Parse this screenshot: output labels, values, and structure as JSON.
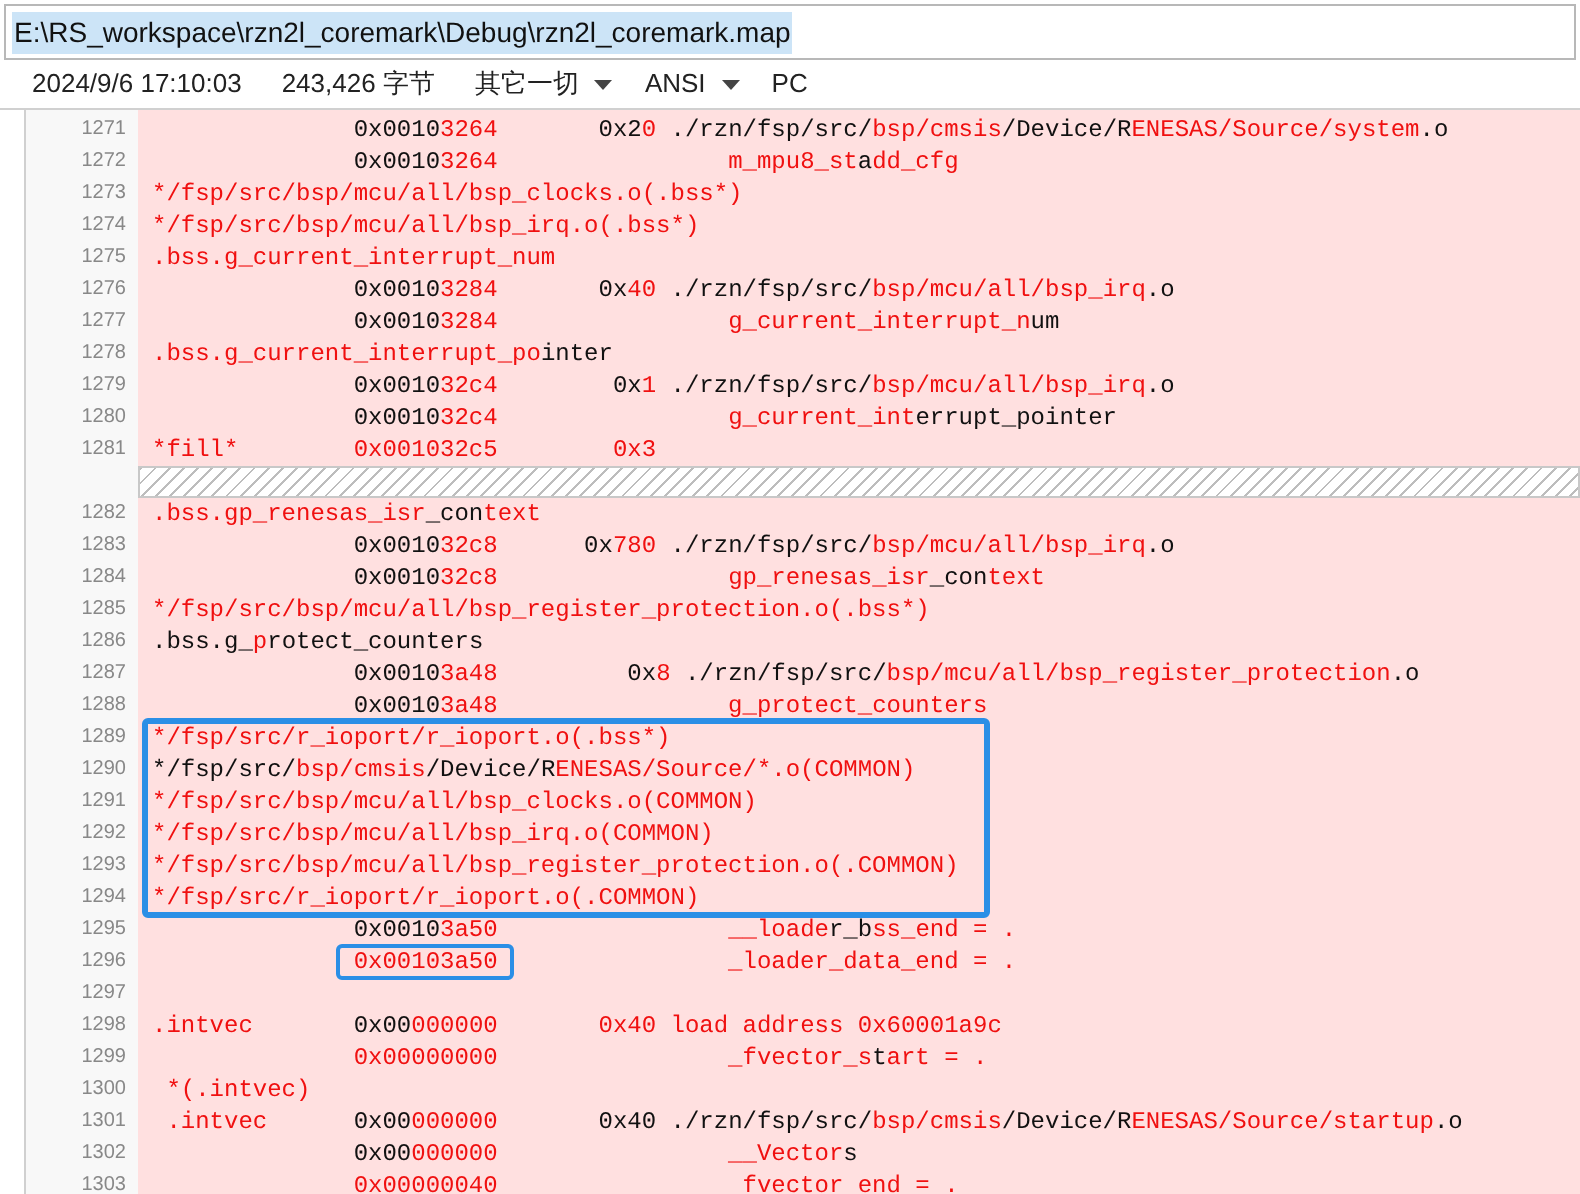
{
  "path_field": {
    "value": "E:\\RS_workspace\\rzn2l_coremark\\Debug\\rzn2l_coremark.map"
  },
  "status_bar": [
    {
      "kind": "text",
      "text": "2024/9/6 17:10:03"
    },
    {
      "kind": "text",
      "text": "243,426 字节"
    },
    {
      "kind": "dropdown",
      "text": "其它一切"
    },
    {
      "kind": "dropdown",
      "text": "ANSI"
    },
    {
      "kind": "text",
      "text": "PC"
    }
  ],
  "lines": [
    {
      "kind": "line",
      "num": "1271",
      "segments": [
        {
          "text": "              0x0010",
          "changed": false
        },
        {
          "text": "3264",
          "changed": true
        },
        {
          "text": "       0x2",
          "changed": false
        },
        {
          "text": "0",
          "changed": true
        },
        {
          "text": " ./rzn/fsp/src/",
          "changed": false
        },
        {
          "text": "bsp/cmsis",
          "changed": true
        },
        {
          "text": "/Device/R",
          "changed": false
        },
        {
          "text": "ENESAS/Source/system",
          "changed": true
        },
        {
          "text": ".o",
          "changed": false
        }
      ]
    },
    {
      "kind": "line",
      "num": "1272",
      "segments": [
        {
          "text": "              0x0010",
          "changed": false
        },
        {
          "text": "3264",
          "changed": true
        },
        {
          "text": "                m_mpu8_st",
          "changed": true
        },
        {
          "text": "a",
          "changed": false
        },
        {
          "text": "dd_cfg",
          "changed": true
        }
      ]
    },
    {
      "kind": "line",
      "num": "1273",
      "segments": [
        {
          "text": "*/fsp/src/bsp/mcu/all/bsp_clocks.o(.bss*)",
          "changed": true
        }
      ]
    },
    {
      "kind": "line",
      "num": "1274",
      "segments": [
        {
          "text": "*/fsp/src/bsp/mcu/all/bsp_irq.o(.bss*)",
          "changed": true
        }
      ]
    },
    {
      "kind": "line",
      "num": "1275",
      "segments": [
        {
          "text": ".bss.g_current_interrupt_num",
          "changed": true
        }
      ]
    },
    {
      "kind": "line",
      "num": "1276",
      "segments": [
        {
          "text": "              0x0010",
          "changed": false
        },
        {
          "text": "3284",
          "changed": true
        },
        {
          "text": "       0x",
          "changed": false
        },
        {
          "text": "40",
          "changed": true
        },
        {
          "text": " ./rzn/fsp/src/",
          "changed": false
        },
        {
          "text": "bsp/mcu/all/bsp_irq",
          "changed": true
        },
        {
          "text": ".o",
          "changed": false
        }
      ]
    },
    {
      "kind": "line",
      "num": "1277",
      "segments": [
        {
          "text": "              0x0010",
          "changed": false
        },
        {
          "text": "3284",
          "changed": true
        },
        {
          "text": "                g_current_interrupt_n",
          "changed": true
        },
        {
          "text": "um",
          "changed": false
        }
      ]
    },
    {
      "kind": "line",
      "num": "1278",
      "segments": [
        {
          "text": ".bss.g_current_interrupt_po",
          "changed": true
        },
        {
          "text": "inter",
          "changed": false
        }
      ]
    },
    {
      "kind": "line",
      "num": "1279",
      "segments": [
        {
          "text": "              0x0010",
          "changed": false
        },
        {
          "text": "32c4",
          "changed": true
        },
        {
          "text": "        0x",
          "changed": false
        },
        {
          "text": "1",
          "changed": true
        },
        {
          "text": " ./rzn/fsp/src/",
          "changed": false
        },
        {
          "text": "bsp/mcu/all/bsp_irq",
          "changed": true
        },
        {
          "text": ".o",
          "changed": false
        }
      ]
    },
    {
      "kind": "line",
      "num": "1280",
      "segments": [
        {
          "text": "              0x0010",
          "changed": false
        },
        {
          "text": "32c4",
          "changed": true
        },
        {
          "text": "                g_current_int",
          "changed": true
        },
        {
          "text": "errupt_pointer",
          "changed": false
        }
      ]
    },
    {
      "kind": "line",
      "num": "1281",
      "segments": [
        {
          "text": "*fill*        0x001032c5        0x3",
          "changed": true
        }
      ]
    },
    {
      "kind": "separator"
    },
    {
      "kind": "line",
      "num": "1282",
      "segments": [
        {
          "text": ".bss.gp_renesas_isr",
          "changed": true
        },
        {
          "text": "_con",
          "changed": false
        },
        {
          "text": "text",
          "changed": true
        }
      ]
    },
    {
      "kind": "line",
      "num": "1283",
      "segments": [
        {
          "text": "              0x0010",
          "changed": false
        },
        {
          "text": "32c8",
          "changed": true
        },
        {
          "text": "      0x",
          "changed": false
        },
        {
          "text": "780",
          "changed": true
        },
        {
          "text": " ./rzn/fsp/src/",
          "changed": false
        },
        {
          "text": "bsp/mcu/all/bsp_irq",
          "changed": true
        },
        {
          "text": ".o",
          "changed": false
        }
      ]
    },
    {
      "kind": "line",
      "num": "1284",
      "segments": [
        {
          "text": "              0x0010",
          "changed": false
        },
        {
          "text": "32c8",
          "changed": true
        },
        {
          "text": "                gp_renesas_isr",
          "changed": true
        },
        {
          "text": "_con",
          "changed": false
        },
        {
          "text": "text",
          "changed": true
        }
      ]
    },
    {
      "kind": "line",
      "num": "1285",
      "segments": [
        {
          "text": "*/fsp/src/bsp/mcu/all/bsp_register_protection.o(.bss*)",
          "changed": true
        }
      ]
    },
    {
      "kind": "line",
      "num": "1286",
      "segments": [
        {
          "text": ".bss.g_",
          "changed": false
        },
        {
          "text": "p",
          "changed": true
        },
        {
          "text": "rotect_counters",
          "changed": false
        }
      ]
    },
    {
      "kind": "line",
      "num": "1287",
      "segments": [
        {
          "text": "              0x0010",
          "changed": false
        },
        {
          "text": "3a48",
          "changed": true
        },
        {
          "text": "         0x",
          "changed": false
        },
        {
          "text": "8",
          "changed": true
        },
        {
          "text": " ./rzn/fsp/src/",
          "changed": false
        },
        {
          "text": "bsp/mcu/all/bsp_register_protection",
          "changed": true
        },
        {
          "text": ".o",
          "changed": false
        }
      ]
    },
    {
      "kind": "line",
      "num": "1288",
      "segments": [
        {
          "text": "              0x0010",
          "changed": false
        },
        {
          "text": "3a48                g_protect_counters",
          "changed": true
        }
      ]
    },
    {
      "kind": "boxed_group",
      "lines": [
        {
          "kind": "line",
          "num": "1289",
          "segments": [
            {
              "text": "*/fsp/src/r_ioport/r_ioport.o(.bss*)",
              "changed": true
            }
          ]
        },
        {
          "kind": "line",
          "num": "1290",
          "segments": [
            {
              "text": "*/fsp/src/",
              "changed": false
            },
            {
              "text": "bsp/cmsis",
              "changed": true
            },
            {
              "text": "/Device/R",
              "changed": false
            },
            {
              "text": "ENESAS/Source/*.o(COMMON)",
              "changed": true
            }
          ]
        },
        {
          "kind": "line",
          "num": "1291",
          "segments": [
            {
              "text": "*/fsp/src/bsp/mcu/all/bsp_clocks.o(COMMON)",
              "changed": true
            }
          ]
        },
        {
          "kind": "line",
          "num": "1292",
          "segments": [
            {
              "text": "*/fsp/src/bsp/mcu/all/bsp_irq.o(COMMON)",
              "changed": true
            }
          ]
        },
        {
          "kind": "line",
          "num": "1293",
          "segments": [
            {
              "text": "*/fsp/src/bsp/mcu/all/bsp_register_protection.o(.COMMON)",
              "changed": true
            }
          ]
        },
        {
          "kind": "line",
          "num": "1294",
          "segments": [
            {
              "text": "*/fsp/src/r_ioport/r_ioport.o(.COMMON)",
              "changed": true
            }
          ]
        }
      ]
    },
    {
      "kind": "line",
      "num": "1295",
      "segments": [
        {
          "text": "              0x0010",
          "changed": false
        },
        {
          "text": "3a50",
          "changed": true
        },
        {
          "text": "                __loade",
          "changed": true
        },
        {
          "text": "r_b",
          "changed": false
        },
        {
          "text": "ss_end = .",
          "changed": true
        }
      ]
    },
    {
      "kind": "line",
      "num": "1296",
      "segments": [
        {
          "text": "              0x00103a50",
          "changed": true,
          "boxed": true
        },
        {
          "text": "                _loader_data_end = .",
          "changed": true
        }
      ]
    },
    {
      "kind": "line",
      "num": "1297"
    },
    {
      "kind": "line",
      "num": "1298",
      "segments": [
        {
          "text": ".intvec",
          "changed": true
        },
        {
          "text": "       0x00",
          "changed": false
        },
        {
          "text": "000000       0x40 load address 0x60001a9c",
          "changed": true
        }
      ]
    },
    {
      "kind": "line",
      "num": "1299",
      "segments": [
        {
          "text": "              0x00000000                _fvector_s",
          "changed": true
        },
        {
          "text": "t",
          "changed": false
        },
        {
          "text": "art = .",
          "changed": true
        }
      ]
    },
    {
      "kind": "line",
      "num": "1300",
      "segments": [
        {
          "text": " *(.intvec)",
          "changed": true
        }
      ]
    },
    {
      "kind": "line",
      "num": "1301",
      "segments": [
        {
          "text": " .intvec",
          "changed": true
        },
        {
          "text": "      0x00",
          "changed": false
        },
        {
          "text": "000000",
          "changed": true
        },
        {
          "text": "       0x40 ./rzn/fsp/src/",
          "changed": false
        },
        {
          "text": "bsp/cmsis",
          "changed": true
        },
        {
          "text": "/Device/R",
          "changed": false
        },
        {
          "text": "ENESAS/Source/startup",
          "changed": true
        },
        {
          "text": ".o",
          "changed": false
        }
      ]
    },
    {
      "kind": "line",
      "num": "1302",
      "segments": [
        {
          "text": "              0x00",
          "changed": false
        },
        {
          "text": "000000                __Vector",
          "changed": true
        },
        {
          "text": "s",
          "changed": false
        }
      ]
    },
    {
      "kind": "line",
      "num": "1303",
      "segments": [
        {
          "text": "              0x00000040                 fvector end = .",
          "changed": true
        }
      ]
    }
  ]
}
